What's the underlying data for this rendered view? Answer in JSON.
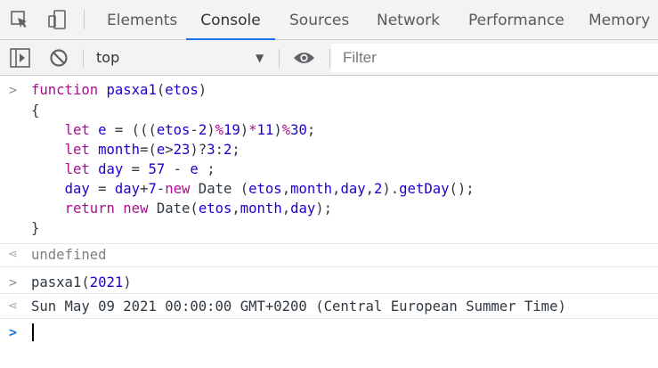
{
  "devtools": {
    "tabs": [
      {
        "label": "Elements"
      },
      {
        "label": "Console"
      },
      {
        "label": "Sources"
      },
      {
        "label": "Network"
      },
      {
        "label": "Performance"
      },
      {
        "label": "Memory"
      }
    ],
    "active_tab": "Console",
    "accent_color": "#1a73e8"
  },
  "console_toolbar": {
    "context": "top",
    "filter_placeholder": "Filter",
    "icons": [
      "sidebar-toggle-icon",
      "clear-console-icon",
      "eye-icon",
      "dropdown-arrow-icon"
    ]
  },
  "console": {
    "input1_lines": [
      "function pasxa1(etos)",
      "{",
      "    let e = (((etos-2)%19)*11)%30;",
      "    let month=(e>23)?3:2;",
      "    let day = 57 - e ;",
      "    day = day+7-new Date (etos,month,day,2).getDay();",
      "    return new Date(etos,month,day);",
      "}"
    ],
    "result1": "undefined",
    "input2": "pasxa1(2021)",
    "result2": "Sun May 09 2021 00:00:00 GMT+0200 (Central European Summer Time)"
  },
  "colors": {
    "keyword": "#aa0d91",
    "identifier": "#1c00cf",
    "prompt_active": "#1a73e8"
  }
}
